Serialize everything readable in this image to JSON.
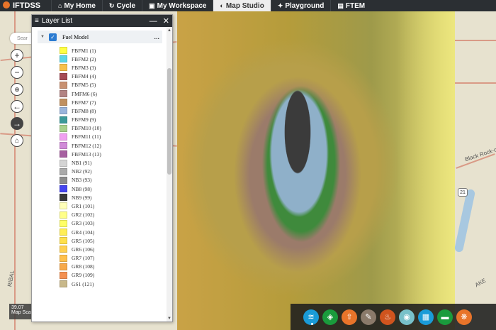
{
  "nav": {
    "logo": "IFTDSS",
    "items": [
      {
        "label": "My Home",
        "icon": "home-icon",
        "glyph": "⌂"
      },
      {
        "label": "Cycle",
        "icon": "cycle-icon",
        "glyph": "↻"
      },
      {
        "label": "My Workspace",
        "icon": "briefcase-icon",
        "glyph": "▣"
      },
      {
        "label": "Map Studio",
        "icon": "globe-icon",
        "glyph": "◐",
        "active": true
      },
      {
        "label": "Playground",
        "icon": "playground-icon",
        "glyph": "✦"
      },
      {
        "label": "FTEM",
        "icon": "ftem-icon",
        "glyph": "▤"
      }
    ]
  },
  "search": {
    "placeholder": "Sear"
  },
  "scale": {
    "value": "39.07",
    "label": "Map Scal"
  },
  "map_labels": {
    "road": "Black Rock-city",
    "route": "21",
    "place": "RIBAL",
    "lake": "AKE"
  },
  "layer_list": {
    "title": "Layer List",
    "layer_name": "Fuel Model",
    "more": "...",
    "legend": [
      {
        "label": "FBFM1 (1)",
        "color": "#ffff44"
      },
      {
        "label": "FBFM2 (2)",
        "color": "#5cd6e6"
      },
      {
        "label": "FBFM3 (3)",
        "color": "#f7c04a"
      },
      {
        "label": "FBFM4 (4)",
        "color": "#a54a55"
      },
      {
        "label": "FBFM5 (5)",
        "color": "#c89070"
      },
      {
        "label": "FMFM6 (6)",
        "color": "#b28383"
      },
      {
        "label": "FBFM7 (7)",
        "color": "#c09060"
      },
      {
        "label": "FBFM8 (8)",
        "color": "#9ab5dc"
      },
      {
        "label": "FBFM9 (9)",
        "color": "#3c9a9a"
      },
      {
        "label": "FBFM10 (10)",
        "color": "#a8d18c"
      },
      {
        "label": "FBFM11 (11)",
        "color": "#f0a0f0"
      },
      {
        "label": "FBFM12 (12)",
        "color": "#d08ad8"
      },
      {
        "label": "FBFM13 (13)",
        "color": "#a65fa0"
      },
      {
        "label": "NB1 (91)",
        "color": "#d4d4d4"
      },
      {
        "label": "NB2 (92)",
        "color": "#aaaaaa"
      },
      {
        "label": "NB3 (93)",
        "color": "#8c8c8c"
      },
      {
        "label": "NB8 (98)",
        "color": "#4444ee"
      },
      {
        "label": "NB9 (99)",
        "color": "#3a3a3a"
      },
      {
        "label": "GR1 (101)",
        "color": "#ffffb8"
      },
      {
        "label": "GR2 (102)",
        "color": "#ffff88"
      },
      {
        "label": "GR3 (103)",
        "color": "#ffff66"
      },
      {
        "label": "GR4 (104)",
        "color": "#ffee55"
      },
      {
        "label": "GR5 (105)",
        "color": "#ffe04a"
      },
      {
        "label": "GR6 (106)",
        "color": "#ffd050"
      },
      {
        "label": "GR7 (107)",
        "color": "#ffc04c"
      },
      {
        "label": "GR8 (108)",
        "color": "#f7a94a"
      },
      {
        "label": "GR9 (109)",
        "color": "#f49050"
      },
      {
        "label": "GS1 (121)",
        "color": "#c8b88a"
      }
    ]
  },
  "toolbar": [
    {
      "name": "layers-tool-button",
      "glyph": "≋",
      "color": "#1a9bd7"
    },
    {
      "name": "layer-list-tool-button",
      "glyph": "◈",
      "color": "#1a9b3c"
    },
    {
      "name": "upload-tool-button",
      "glyph": "⇧",
      "color": "#e8742a"
    },
    {
      "name": "draw-tool-button",
      "glyph": "✎",
      "color": "#8a7a6a"
    },
    {
      "name": "fire-tool-button",
      "glyph": "♨",
      "color": "#d0541e"
    },
    {
      "name": "bookmark-tool-button",
      "glyph": "◉",
      "color": "#78c1c9"
    },
    {
      "name": "grid-tool-button",
      "glyph": "▦",
      "color": "#1a9bd7"
    },
    {
      "name": "measure-tool-button",
      "glyph": "▬",
      "color": "#1a9b3c"
    },
    {
      "name": "analysis-tool-button",
      "glyph": "❋",
      "color": "#e8742a"
    }
  ]
}
